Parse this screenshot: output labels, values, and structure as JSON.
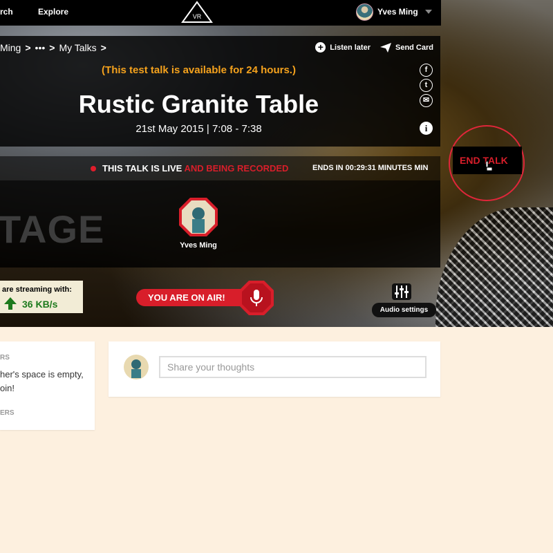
{
  "nav": {
    "search_label": "rch",
    "explore_label": "Explore",
    "logo_text": "VR",
    "user_name": "Yves Ming"
  },
  "breadcrumb": {
    "items": [
      "Ming",
      "•••",
      "My Talks"
    ],
    "separator": ">"
  },
  "actions": {
    "listen_later": "Listen later",
    "send_card": "Send Card"
  },
  "talk": {
    "notice": "(This test talk is available for 24 hours.)",
    "title": "Rustic Granite Table",
    "date": "21st May 2015 | 7:08 - 7:38"
  },
  "social": {
    "facebook": "f",
    "twitter": "t",
    "email": "✉",
    "info": "i"
  },
  "live": {
    "status_white": "THIS TALK IS LIVE ",
    "status_red": "AND BEING RECORDED",
    "ends_in": "ENDS IN  00:29:31 MINUTES MIN"
  },
  "end_talk_label": "END TALK",
  "stage": {
    "word": "TAGE",
    "speaker_name": "Yves Ming"
  },
  "streaming": {
    "label": "are streaming with:",
    "rate": "36 KB/s"
  },
  "on_air_label": "YOU ARE ON AIR!",
  "audio_settings_label": "Audio settings",
  "listeners_card": {
    "heading_1": "RS",
    "text_line_1": "her's space is empty,",
    "text_line_2": "oin!",
    "heading_2": "ERS"
  },
  "comment": {
    "placeholder": "Share your thoughts"
  },
  "colors": {
    "accent_red": "#d81e2a",
    "notice_orange": "#f5a21d",
    "stream_green": "#1d7a1d",
    "page_bg": "#fdf0df"
  }
}
